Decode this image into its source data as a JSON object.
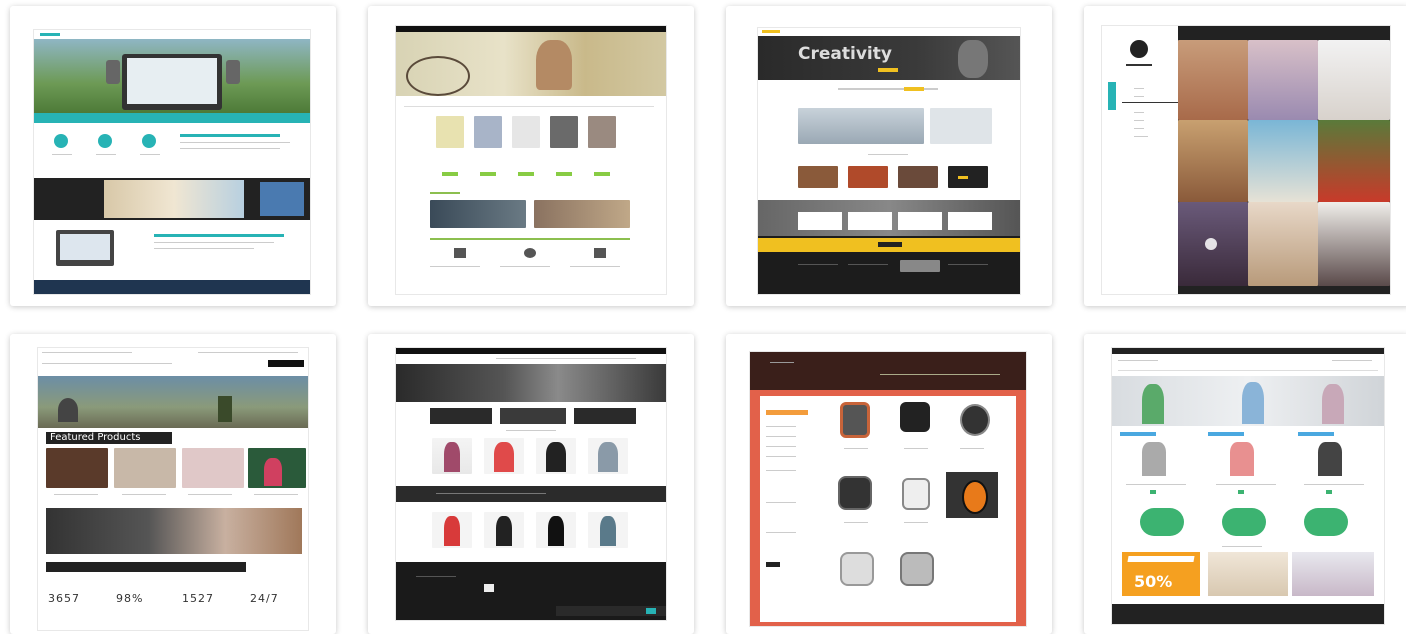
{
  "thumbnails": [
    {
      "id": "teal-tech",
      "accent": "#27b3b5",
      "hero_text": "",
      "caption": ""
    },
    {
      "id": "bike-fashion",
      "accent": "#8cbf4f",
      "hero_text": "",
      "caption": ""
    },
    {
      "id": "creativity-dark",
      "accent": "#f0c020",
      "hero_text": "Creativity",
      "caption": ""
    },
    {
      "id": "fashion-grid",
      "accent": "#27b3b5",
      "hero_text": "",
      "caption": ""
    },
    {
      "id": "featured-products",
      "accent": "#222222",
      "hero_text": "Featured Products",
      "stats": [
        "3657",
        "98%",
        "1527",
        "24/7"
      ]
    },
    {
      "id": "dark-fashion",
      "accent": "#2b2b2b",
      "hero_text": "",
      "caption": ""
    },
    {
      "id": "watch-store",
      "accent": "#e2614a",
      "hero_text": "",
      "caption": ""
    },
    {
      "id": "green-shop",
      "accent": "#3cb371",
      "hero_text": "",
      "promo": "50%"
    }
  ]
}
